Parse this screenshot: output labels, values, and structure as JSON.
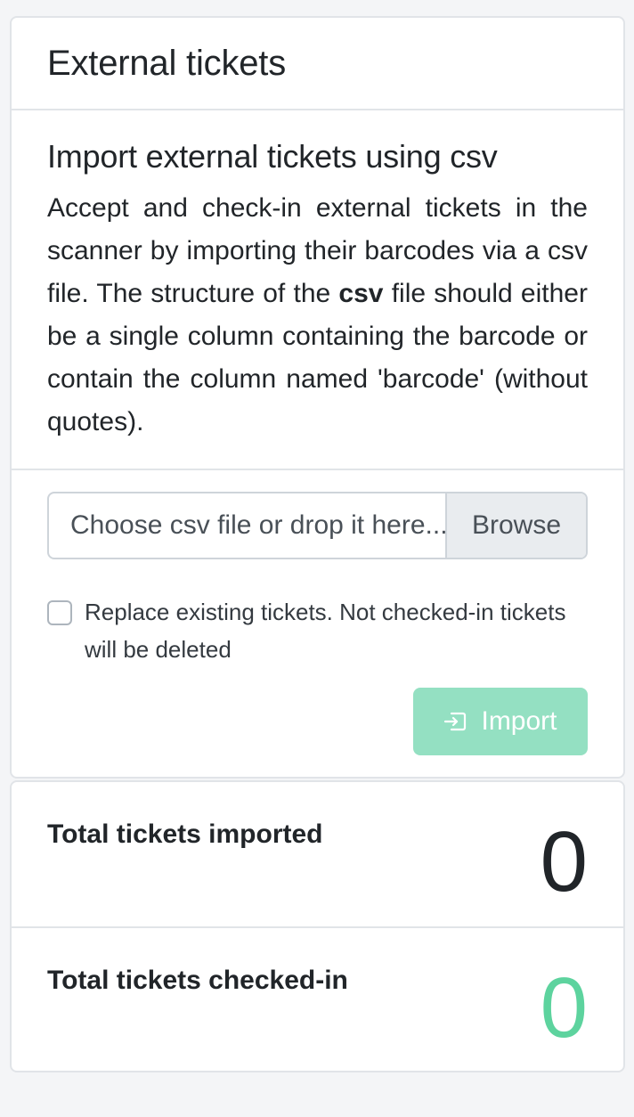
{
  "card": {
    "title": "External tickets"
  },
  "intro": {
    "title": "Import external tickets using csv",
    "description_part1": "Accept and check-in external tickets in the scanner by importing their barcodes via a csv file. The structure of the ",
    "description_bold": "csv",
    "description_part2": " file should either be a single column containing the barcode or contain the column named 'barcode' (without quotes)."
  },
  "form": {
    "file_placeholder": "Choose csv file or drop it here...",
    "browse_label": "Browse",
    "replace_checkbox_label": "Replace existing tickets. Not checked-in tickets will be deleted",
    "replace_checked": false,
    "import_label": "Import",
    "import_icon": "import-icon"
  },
  "stats": {
    "imported_label": "Total tickets imported",
    "imported_value": "0",
    "checked_in_label": "Total tickets checked-in",
    "checked_in_value": "0"
  },
  "colors": {
    "accent_green": "#5dd39e",
    "import_button_disabled": "#94e0c2"
  }
}
